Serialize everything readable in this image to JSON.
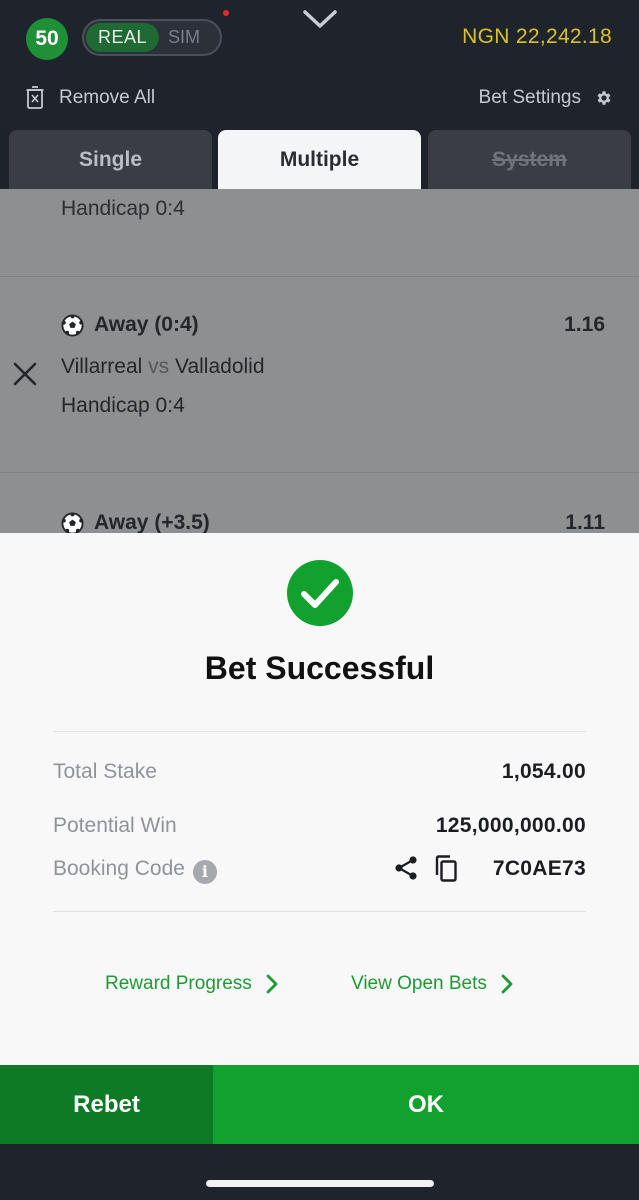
{
  "header": {
    "badge_count": "50",
    "mode_toggle": {
      "real_label": "REAL",
      "sim_label": "SIM",
      "selected": "REAL"
    },
    "balance": "NGN 22,242.18",
    "remove_all_label": "Remove All",
    "bet_settings_label": "Bet Settings",
    "icons": [
      "chevron-down-icon",
      "trash-icon",
      "gear-icon"
    ]
  },
  "tabs": [
    {
      "label": "Single",
      "active": false
    },
    {
      "label": "Multiple",
      "active": true
    },
    {
      "label": "System",
      "active": false,
      "disabled": true
    }
  ],
  "bets": [
    {
      "handicap": "Handicap 0:4"
    },
    {
      "market": "Away (0:4)",
      "odds": "1.16",
      "home": "Villarreal",
      "vs": "vs",
      "away": "Valladolid",
      "handicap": "Handicap 0:4"
    },
    {
      "market": "Away (+3.5)",
      "odds": "1.11"
    }
  ],
  "modal": {
    "title": "Bet Successful",
    "total_stake_label": "Total Stake",
    "total_stake_value": "1,054.00",
    "potential_win_label": "Potential Win",
    "potential_win_value": "125,000,000.00",
    "booking_code_label": "Booking Code",
    "booking_code_value": "7C0AE73",
    "reward_progress_label": "Reward Progress",
    "view_open_bets_label": "View Open Bets"
  },
  "actions": {
    "rebet_label": "Rebet",
    "ok_label": "OK"
  },
  "colors": {
    "brand_green": "#12a12f",
    "dark_green": "#0e7a26",
    "balance_yellow": "#d7c22a",
    "header_bg": "#1f232c"
  }
}
